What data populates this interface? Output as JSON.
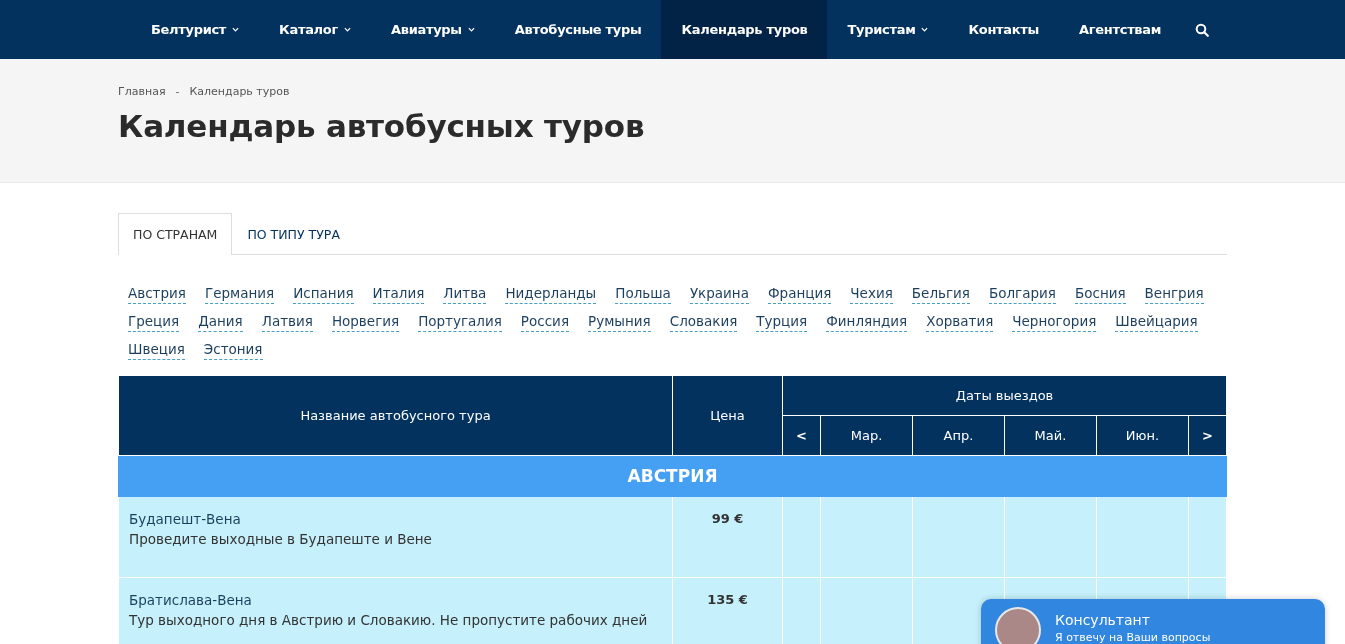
{
  "nav": {
    "items": [
      {
        "label": "Белтурист",
        "dropdown": true,
        "selected": false
      },
      {
        "label": "Каталог",
        "dropdown": true,
        "selected": false
      },
      {
        "label": "Авиатуры",
        "dropdown": true,
        "selected": false
      },
      {
        "label": "Автобусные туры",
        "dropdown": false,
        "selected": false
      },
      {
        "label": "Календарь туров",
        "dropdown": false,
        "selected": true
      },
      {
        "label": "Туристам",
        "dropdown": true,
        "selected": false
      },
      {
        "label": "Контакты",
        "dropdown": false,
        "selected": false
      },
      {
        "label": "Агентствам",
        "dropdown": false,
        "selected": false
      }
    ]
  },
  "breadcrumbs": [
    "Главная",
    "Календарь туров"
  ],
  "breadcrumb_separator": "-",
  "title": "Календарь автобусных туров",
  "tabs": [
    {
      "label": "ПО СТРАНАМ",
      "selected": true
    },
    {
      "label": "ПО ТИПУ ТУРА",
      "selected": false
    }
  ],
  "countries": [
    "Австрия",
    "Германия",
    "Испания",
    "Италия",
    "Литва",
    "Нидерланды",
    "Польша",
    "Украина",
    "Франция",
    "Чехия",
    "Бельгия",
    "Болгария",
    "Босния",
    "Венгрия",
    "Греция",
    "Дания",
    "Латвия",
    "Норвегия",
    "Португалия",
    "Россия",
    "Румыния",
    "Словакия",
    "Турция",
    "Финляндия",
    "Хорватия",
    "Черногория",
    "Швейцария",
    "Швеция",
    "Эстония"
  ],
  "table": {
    "columns": {
      "name": "Название автобусного тура",
      "price": "Цена",
      "dates": "Даты выездов",
      "prev": "<",
      "months": [
        "Мар.",
        "Апр.",
        "Май.",
        "Июн."
      ],
      "next": ">"
    },
    "groups": [
      {
        "country": "АВСТРИЯ",
        "rows": [
          {
            "name": "Будапешт-Вена",
            "description": "Проведите выходные в Будапеште и Вене",
            "price": "99 €"
          },
          {
            "name": "Братислава-Вена",
            "description": "Тур выходного дня в Австрию и Словакию. Не пропустите рабочих дней",
            "price": "135 €"
          }
        ]
      }
    ]
  },
  "chat": {
    "title": "Консультант",
    "subtitle": "Я отвечу на Ваши вопросы"
  }
}
